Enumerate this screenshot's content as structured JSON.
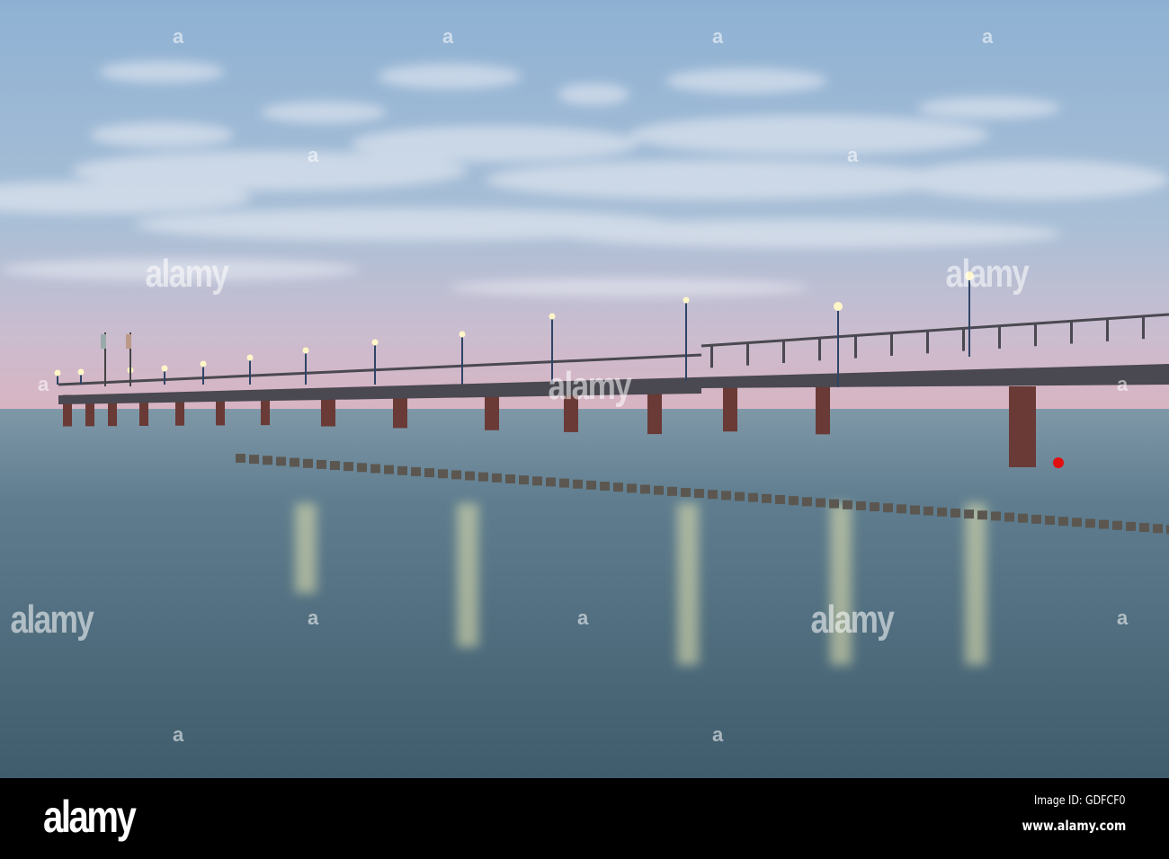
{
  "watermark": {
    "text": "alamy",
    "mark": "a"
  },
  "footer": {
    "logo": "alamy",
    "image_id": "Image ID: GDFCF0",
    "url": "www.alamy.com"
  },
  "colors": {
    "sky_top": "#8fb0d0",
    "horizon_pink": "#d9b6c4",
    "sea": "#4f6f80",
    "pier": "#4a4a50",
    "pillar": "#6a3a36",
    "buoy": "#e01010"
  }
}
